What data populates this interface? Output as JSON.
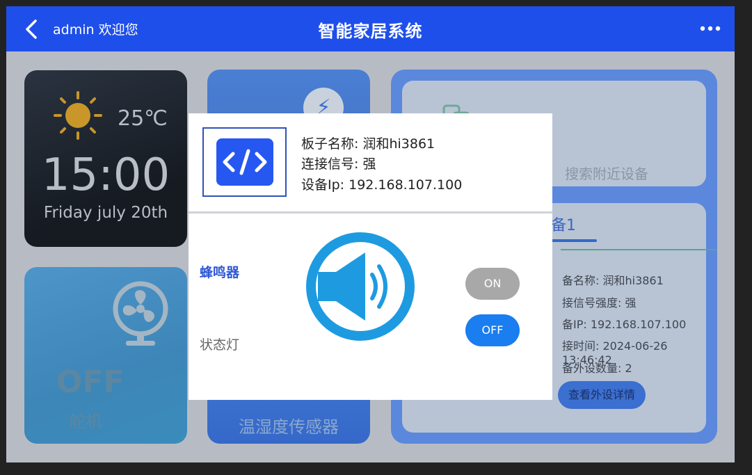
{
  "header": {
    "user_greeting": "admin 欢迎您",
    "title": "智能家居系统",
    "back_icon": "chevron-left-icon",
    "more_icon": "more-horizontal-icon"
  },
  "weather": {
    "temperature": "25℃",
    "time": "15:00",
    "date": "Friday july 20th",
    "icon": "sun-icon"
  },
  "fan_card": {
    "state": "OFF",
    "label": "舵机",
    "icon": "fan-icon"
  },
  "sensor_card": {
    "label": "温湿度传感器"
  },
  "right_panel": {
    "search_label": "搜索附近设备",
    "device_tab": "备1",
    "device_info": [
      "备名称: 润和hi3861",
      "接信号强度: 强",
      "备IP: 192.168.107.100",
      "接时间: 2024-06-26 13:46:42",
      "备外设数量: 2"
    ],
    "details_button": "查看外设详情"
  },
  "modal": {
    "board_name": "板子名称: 润和hi3861",
    "signal": "连接信号: 强",
    "device_ip": "设备Ip: 192.168.107.100",
    "buzzer_label": "蜂鸣器",
    "led_label": "状态灯",
    "on_label": "ON",
    "off_label": "OFF",
    "board_icon": "code-icon",
    "speaker_icon": "speaker-icon"
  },
  "colors": {
    "header_bg": "#1f4fea",
    "accent": "#2657f0",
    "toggle_on_bg": "#a8a8a8",
    "toggle_off_bg": "#1a7df0",
    "speaker_blue": "#1e9be0"
  }
}
